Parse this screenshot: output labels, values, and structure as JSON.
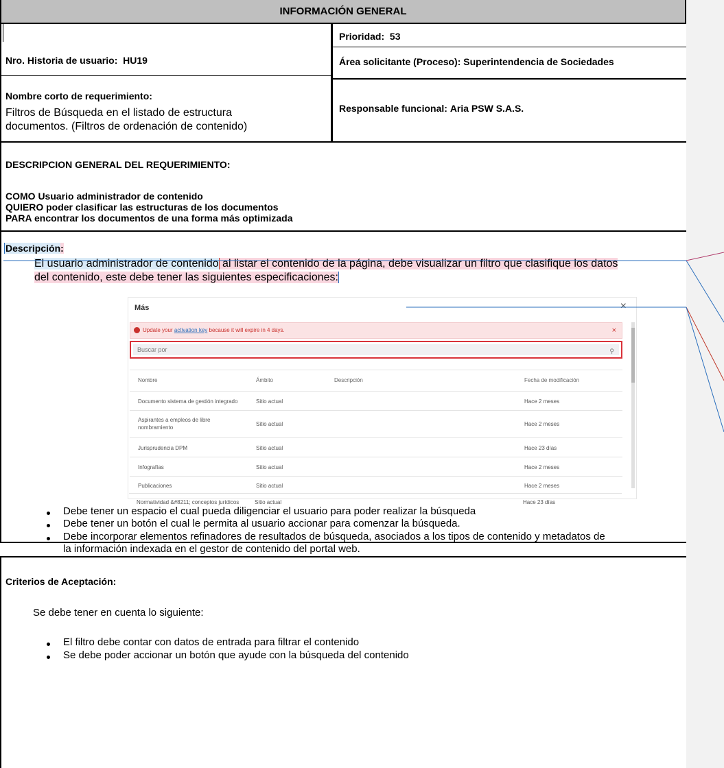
{
  "header": {
    "title": "INFORMACIÓN GENERAL"
  },
  "info": {
    "nro_label": "Nro. Historia de usuario:",
    "nro_value": "HU19",
    "prioridad_label": "Prioridad:",
    "prioridad_value": "53",
    "area_label": "Área solicitante (Proceso):",
    "area_value": "Superintendencia de Sociedades",
    "nombre_label": "Nombre corto de requerimiento:",
    "nombre_line1": "Filtros de Búsqueda en el listado de estructura",
    "nombre_line2": "documentos. (Filtros de ordenación de contenido)",
    "responsable_label": "Responsable funcional:",
    "responsable_value": "Aria PSW S.A.S."
  },
  "descripcion_general": {
    "heading": "DESCRIPCION GENERAL DEL REQUERIMIENTO:",
    "como": "COMO Usuario administrador de contenido",
    "quiero": "QUIERO poder clasificar las estructuras de los documentos",
    "para": "PARA  encontrar los documentos de una forma más optimizada"
  },
  "descripcion": {
    "heading": "Descripción",
    "colon": ":",
    "intro_hl": "El usuario administrador de contenido",
    "intro_rest_1": " al listar el contenido de la página, debe visualizar un filtro que clasifique los datos",
    "intro_rest_2": "del contenido, este debe tener las siguientes especificaciones:"
  },
  "screenshot": {
    "title": "Más",
    "close": "×",
    "alert_pre": "Update your ",
    "alert_link": "activation key",
    "alert_post": " because it will expire in 4 days.",
    "alert_close": "×",
    "search_placeholder": "Buscar por",
    "search_icon": "magnifier-icon",
    "columns": [
      "Nombre",
      "Ámbito",
      "Descripción",
      "Fecha de modificación"
    ],
    "rows": [
      {
        "nombre": "Documento sistema de gestión integrado",
        "ambito": "Sitio actual",
        "fecha": "Hace 2 meses"
      },
      {
        "nombre": "Aspirantes a empleos de libre",
        "nombre2": "nombramiento",
        "ambito": "Sitio actual",
        "fecha": "Hace 2 meses"
      },
      {
        "nombre": "Jurisprudencia DPM",
        "ambito": "Sitio actual",
        "fecha": "Hace 23 días"
      },
      {
        "nombre": "Infografías",
        "ambito": "Sitio actual",
        "fecha": "Hace 2 meses"
      },
      {
        "nombre": "Publicaciones",
        "ambito": "Sitio actual",
        "fecha": "Hace 2 meses"
      },
      {
        "nombre": "Normatividad &#8211; conceptos jurídicos",
        "ambito": "Sitio actual",
        "fecha": "Hace 23 días"
      }
    ]
  },
  "bullets": [
    "Debe tener un espacio el cual pueda diligenciar el usuario para poder realizar la búsqueda",
    "Debe tener un botón el cual le permita al usuario accionar para comenzar la búsqueda.",
    "Debe incorporar elementos refinadores de resultados de búsqueda, asociados a los tipos de contenido y metadatos de",
    "la información indexada en el gestor de contenido del portal web."
  ],
  "criterios": {
    "heading": "Criterios de Aceptación:",
    "intro": "Se debe tener en cuenta lo siguiente:",
    "items": [
      "El filtro debe contar con datos de entrada para filtrar el contenido",
      "Se debe poder accionar un botón que ayude con la búsqueda del contenido"
    ]
  },
  "colors": {
    "header_bg": "#bfbfbf",
    "highlight_blue": "#d9eaf7",
    "highlight_pink": "#f9d6df",
    "sidebar": "#f2f2f2",
    "search_border": "#d9323a"
  }
}
